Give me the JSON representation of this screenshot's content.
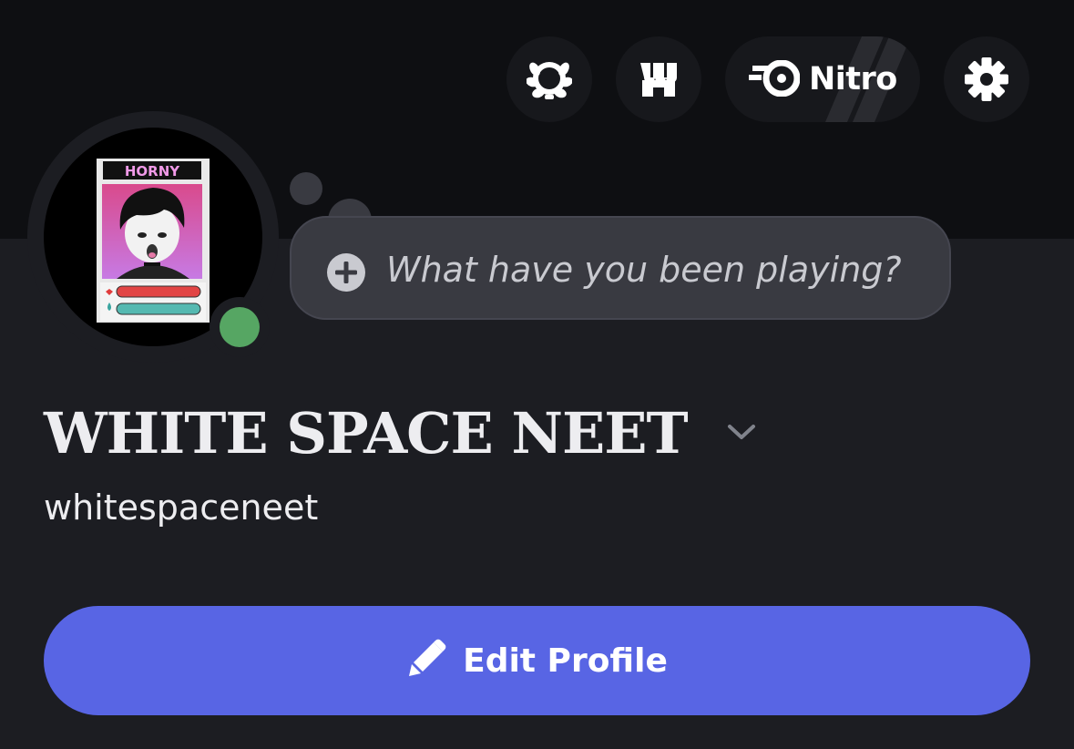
{
  "header": {
    "buttons": [
      {
        "id": "quests",
        "icon": "laurel-wreath-icon"
      },
      {
        "id": "shop",
        "icon": "shop-storefront-icon"
      },
      {
        "id": "nitro",
        "icon": "nitro-icon",
        "label": "Nitro"
      },
      {
        "id": "settings",
        "icon": "gear-icon"
      }
    ]
  },
  "profile": {
    "avatar": {
      "alt": "profile avatar",
      "card_label": "HORNY"
    },
    "status": {
      "state": "online",
      "color": "#56a663"
    },
    "activity_prompt": "What have you been playing?",
    "display_name": "WHITE SPACE NEET",
    "username": "whitespaceneet"
  },
  "actions": {
    "edit_profile_label": "Edit Profile",
    "edit_icon": "pencil-icon"
  },
  "colors": {
    "background": "#1c1d22",
    "banner": "#0e0f12",
    "accent": "#5865e4",
    "bubble": "#393a41"
  }
}
